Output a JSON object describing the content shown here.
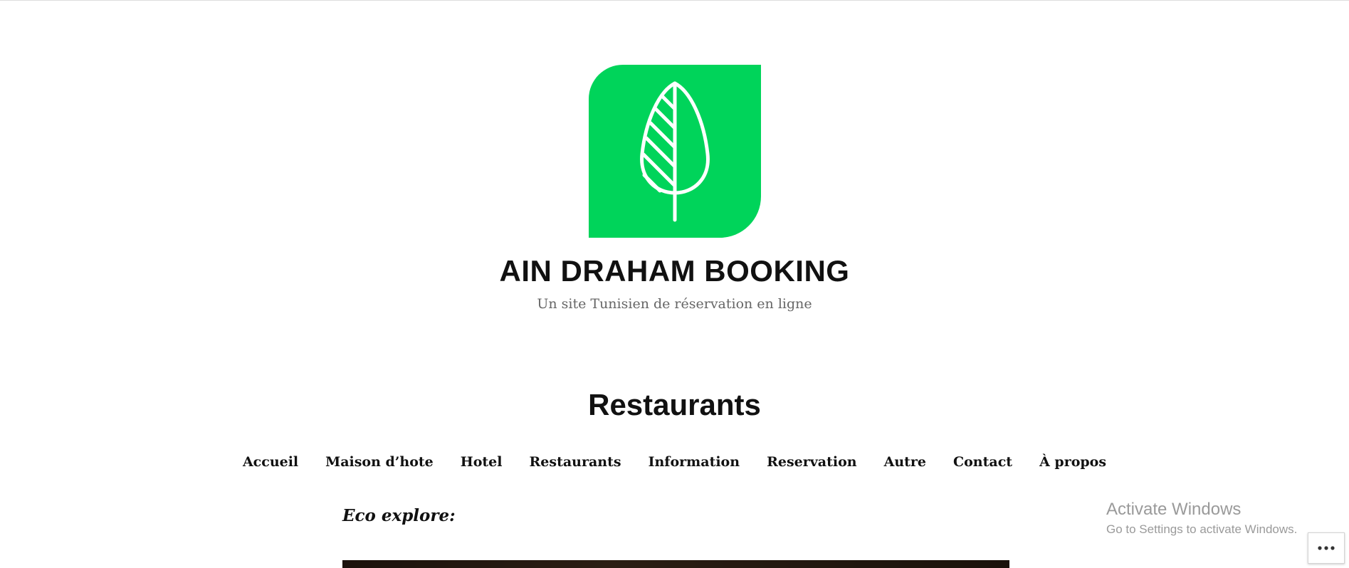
{
  "site": {
    "title": "AIN DRAHAM BOOKING",
    "tagline": "Un site Tunisien de réservation en ligne",
    "logo_icon": "leaf-icon",
    "brand_color": "#00d45a"
  },
  "page": {
    "title": "Restaurants"
  },
  "nav": {
    "items": [
      {
        "label": "Accueil"
      },
      {
        "label": "Maison d’hote"
      },
      {
        "label": "Hotel"
      },
      {
        "label": "Restaurants"
      },
      {
        "label": "Information"
      },
      {
        "label": "Reservation"
      },
      {
        "label": "Autre"
      },
      {
        "label": "Contact"
      },
      {
        "label": "À propos"
      }
    ]
  },
  "content": {
    "heading": "Eco explore:"
  },
  "watermark": {
    "title": "Activate Windows",
    "subtitle": "Go to Settings to activate Windows."
  },
  "actions": {
    "more_icon": "more-horizontal-icon"
  }
}
